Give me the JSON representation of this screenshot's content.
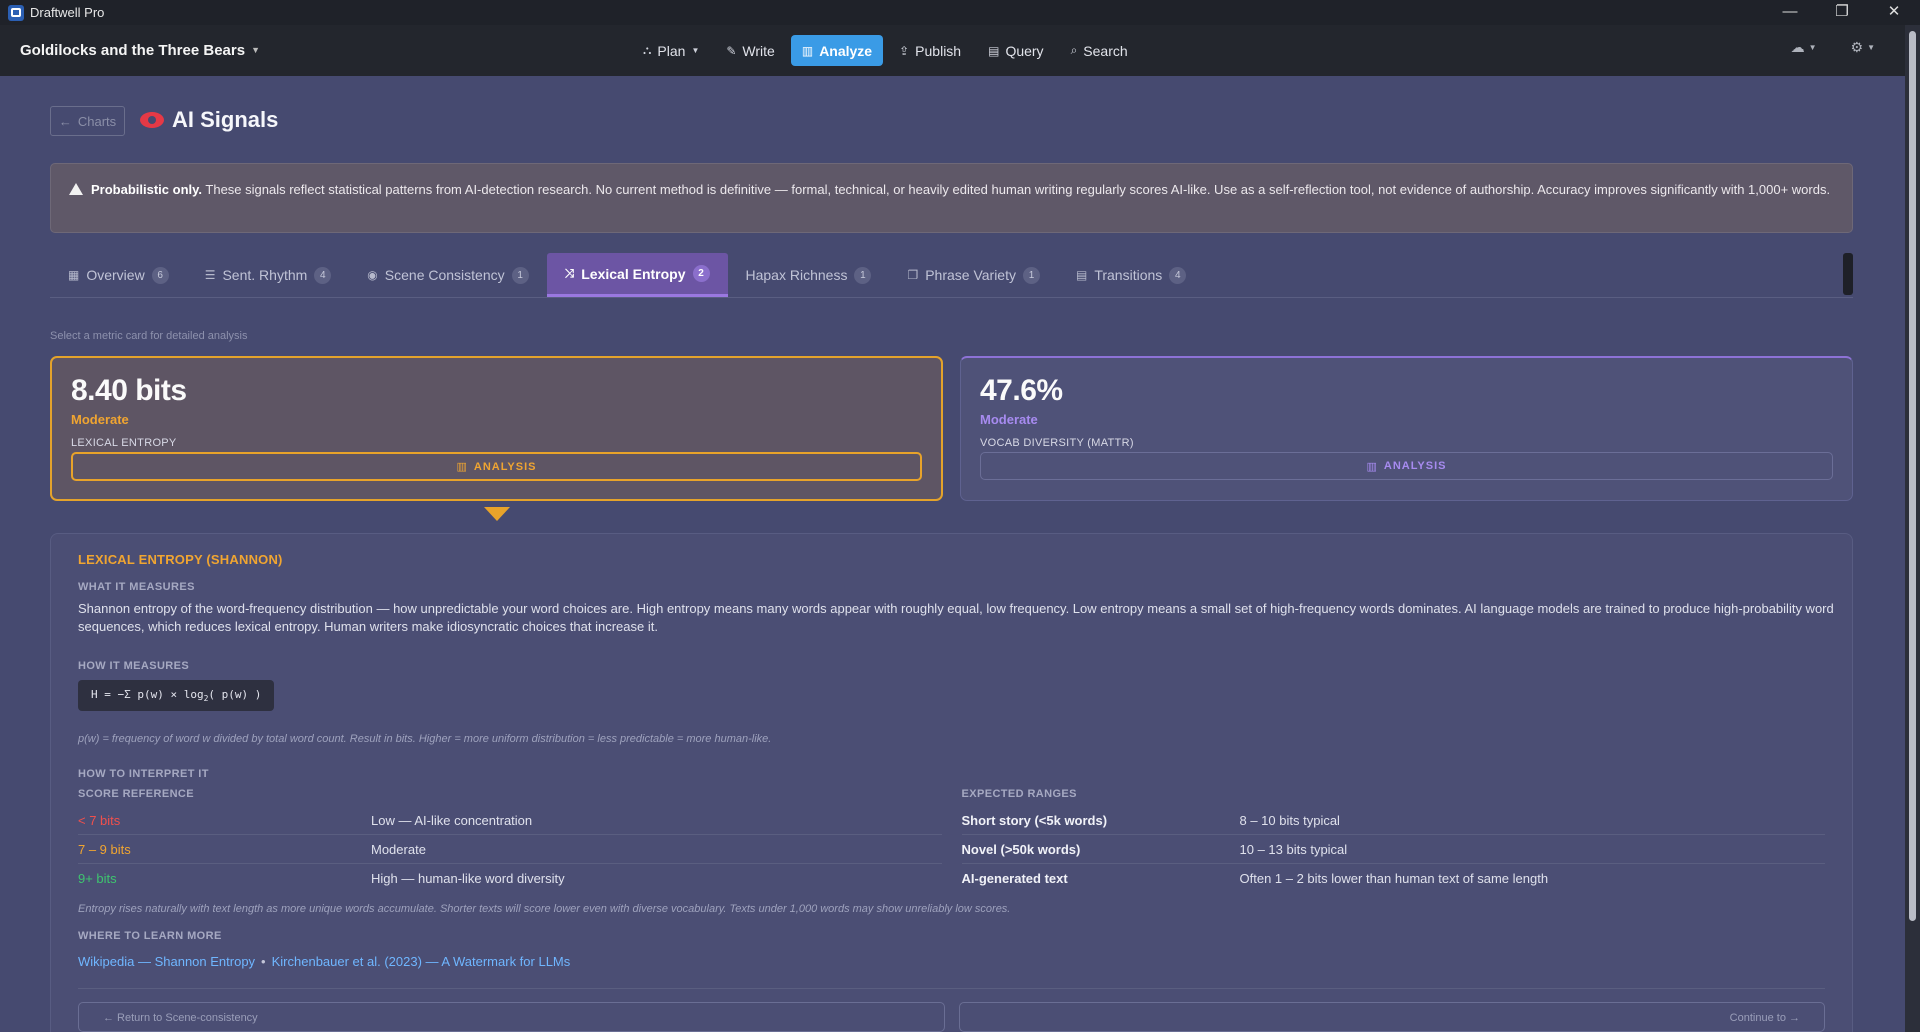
{
  "window": {
    "title": "Draftwell Pro",
    "minimize": "—",
    "maximize": "❐",
    "close": "✕"
  },
  "header": {
    "doc_title": "Goldilocks and the Three Bears",
    "nav": [
      {
        "label": "Plan"
      },
      {
        "label": "Write"
      },
      {
        "label": "Analyze"
      },
      {
        "label": "Publish"
      },
      {
        "label": "Query"
      },
      {
        "label": "Search"
      }
    ]
  },
  "page": {
    "back_label": "Charts",
    "title": "AI Signals"
  },
  "notice": {
    "bold": "Probabilistic only.",
    "text": " These signals reflect statistical patterns from AI-detection research. No current method is definitive — formal, technical, or heavily edited human writing regularly scores AI-like. Use as a self-reflection tool, not evidence of authorship. Accuracy improves significantly with 1,000+ words."
  },
  "tabs": [
    {
      "label": "Overview",
      "count": "6"
    },
    {
      "label": "Sent. Rhythm",
      "count": "4"
    },
    {
      "label": "Scene Consistency",
      "count": "1"
    },
    {
      "label": "Lexical Entropy",
      "count": "2"
    },
    {
      "label": "Hapax Richness",
      "count": "1"
    },
    {
      "label": "Phrase Variety",
      "count": "1"
    },
    {
      "label": "Transitions",
      "count": "4"
    }
  ],
  "hint": "Select a metric card for detailed analysis",
  "cards": [
    {
      "value": "8.40 bits",
      "level": "Moderate",
      "label": "LEXICAL ENTROPY",
      "button": "ANALYSIS"
    },
    {
      "value": "47.6%",
      "level": "Moderate",
      "label": "VOCAB DIVERSITY (MATTR)",
      "button": "ANALYSIS"
    }
  ],
  "detail": {
    "title": "LEXICAL ENTROPY (SHANNON)",
    "what_heading": "WHAT IT MEASURES",
    "what_text": "Shannon entropy of the word-frequency distribution — how unpredictable your word choices are. High entropy means many words appear with roughly equal, low frequency. Low entropy means a small set of high-frequency words dominates. AI language models are trained to produce high-probability word sequences, which reduces lexical entropy. Human writers make idiosyncratic choices that increase it.",
    "how_heading": "HOW IT MEASURES",
    "formula_a": "H = −Σ p(w) × log",
    "formula_sub": "2",
    "formula_b": "( p(w) )",
    "formula_note": "p(w) = frequency of word w divided by total word count. Result in bits. Higher = more uniform distribution = less predictable = more human-like.",
    "interp_heading": "HOW TO INTERPRET IT",
    "score_heading": "SCORE REFERENCE",
    "scores": [
      {
        "range": "< 7 bits",
        "meaning": "Low — AI-like concentration"
      },
      {
        "range": "7 – 9 bits",
        "meaning": "Moderate"
      },
      {
        "range": "9+ bits",
        "meaning": "High — human-like word diversity"
      }
    ],
    "ranges_heading": "EXPECTED RANGES",
    "ranges": [
      {
        "kind": "Short story (<5k words)",
        "value": "8 – 10 bits typical"
      },
      {
        "kind": "Novel (>50k words)",
        "value": "10 – 13 bits typical"
      },
      {
        "kind": "AI-generated text",
        "value": "Often 1 – 2 bits lower than human text of same length"
      }
    ],
    "interp_note": "Entropy rises naturally with text length as more unique words accumulate. Shorter texts will score lower even with diverse vocabulary. Texts under 1,000 words may show unreliably low scores.",
    "learn_heading": "WHERE TO LEARN MORE",
    "links": [
      "Wikipedia — Shannon Entropy",
      "Kirchenbauer et al. (2023) — A Watermark for LLMs"
    ],
    "back_button": "← Return to Scene-consistency",
    "next_button": "Continue to →"
  }
}
